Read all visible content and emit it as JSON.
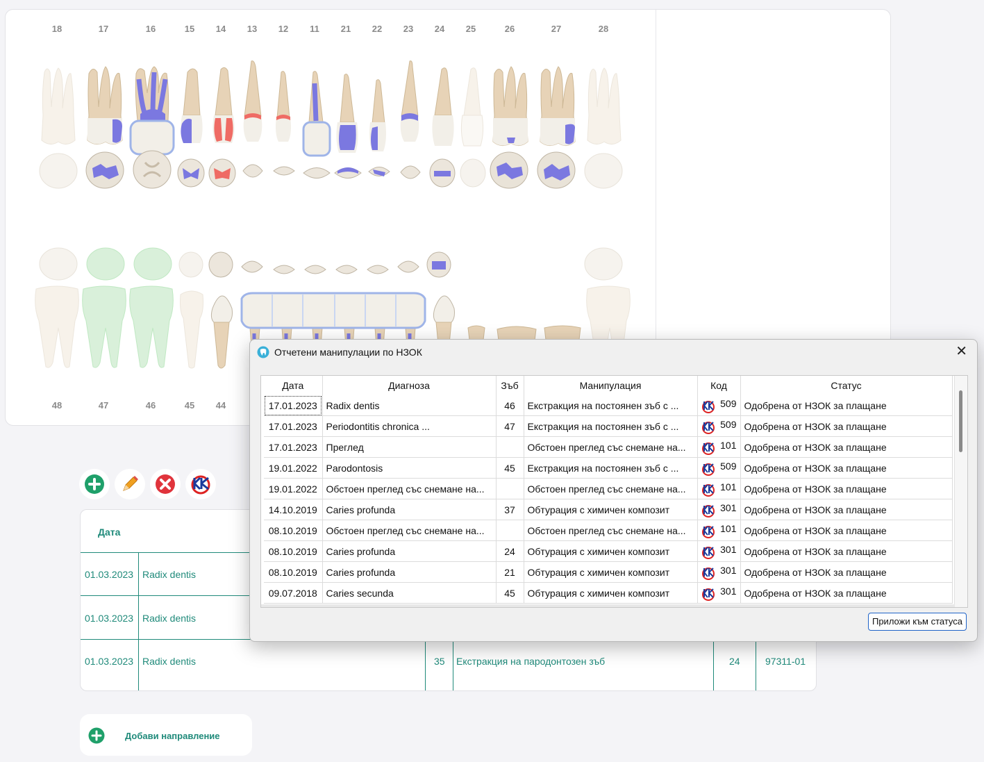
{
  "chart": {
    "upper_numbers": [
      "18",
      "17",
      "16",
      "15",
      "14",
      "13",
      "12",
      "11",
      "21",
      "22",
      "23",
      "24",
      "25",
      "26",
      "27",
      "28"
    ],
    "lower_numbers": [
      "48",
      "47",
      "46",
      "45",
      "44"
    ]
  },
  "toolbar": {
    "add_icon": "plus-circle-icon",
    "edit_icon": "pencil-icon",
    "delete_icon": "x-circle-icon",
    "nzok_icon": "nzok-logo-icon"
  },
  "records": {
    "header_date": "Дата",
    "rows": [
      {
        "date": "01.03.2023",
        "diagnosis": "Radix dentis"
      },
      {
        "date": "01.03.2023",
        "diagnosis": "Radix dentis"
      },
      {
        "date": "01.03.2023",
        "diagnosis": "Radix dentis",
        "tooth": "35",
        "procedure": "Екстракция на пародонтозен зъб",
        "code": "24",
        "ref": "97311-01"
      }
    ]
  },
  "add_referral": {
    "label": "Добави направление"
  },
  "dialog": {
    "title": "Отчетени манипулации по НЗОК",
    "columns": [
      "Дата",
      "Диагноза",
      "Зъб",
      "Манипулация",
      "Код",
      "Статус"
    ],
    "rows": [
      {
        "date": "17.01.2023",
        "diagnosis": "Radix dentis",
        "tooth": "46",
        "procedure": "Екстракция на постоянен зъб с ...",
        "code": "509",
        "status": "Одобрена от НЗОК за плащане"
      },
      {
        "date": "17.01.2023",
        "diagnosis": "Periodontitis chronica ...",
        "tooth": "47",
        "procedure": "Екстракция на постоянен зъб с ...",
        "code": "509",
        "status": "Одобрена от НЗОК за плащане"
      },
      {
        "date": "17.01.2023",
        "diagnosis": "Преглед",
        "tooth": "",
        "procedure": "Обстоен преглед със снемане на...",
        "code": "101",
        "status": "Одобрена от НЗОК за плащане"
      },
      {
        "date": "19.01.2022",
        "diagnosis": "Parodontosis",
        "tooth": "45",
        "procedure": "Екстракция на постоянен зъб с ...",
        "code": "509",
        "status": "Одобрена от НЗОК за плащане"
      },
      {
        "date": "19.01.2022",
        "diagnosis": "Обстоен преглед със снемане на...",
        "tooth": "",
        "procedure": "Обстоен преглед със снемане на...",
        "code": "101",
        "status": "Одобрена от НЗОК за плащане"
      },
      {
        "date": "14.10.2019",
        "diagnosis": "Caries profunda",
        "tooth": "37",
        "procedure": "Обтурация с химичен композит",
        "code": "301",
        "status": "Одобрена от НЗОК за плащане"
      },
      {
        "date": "08.10.2019",
        "diagnosis": "Обстоен преглед със снемане на...",
        "tooth": "",
        "procedure": "Обстоен преглед със снемане на...",
        "code": "101",
        "status": "Одобрена от НЗОК за плащане"
      },
      {
        "date": "08.10.2019",
        "diagnosis": "Caries profunda",
        "tooth": "24",
        "procedure": "Обтурация с химичен композит",
        "code": "301",
        "status": "Одобрена от НЗОК за плащане"
      },
      {
        "date": "08.10.2019",
        "diagnosis": "Caries profunda",
        "tooth": "21",
        "procedure": "Обтурация с химичен композит",
        "code": "301",
        "status": "Одобрена от НЗОК за плащане"
      },
      {
        "date": "09.07.2018",
        "diagnosis": "Caries secunda",
        "tooth": "45",
        "procedure": "Обтурация с химичен композит",
        "code": "301",
        "status": "Одобрена от НЗОК за плащане"
      }
    ],
    "apply_button": "Приложи към статуса",
    "close_icon": "close-icon",
    "title_icon": "tooth-icon"
  },
  "colors": {
    "accent": "#1f8a7a",
    "filling": "#7b78e0",
    "caries": "#ef6b64",
    "crown": "#c9d6f2",
    "missing_green": "#bfe8c2",
    "add_green": "#1fa06a",
    "delete_red": "#e0343c"
  }
}
